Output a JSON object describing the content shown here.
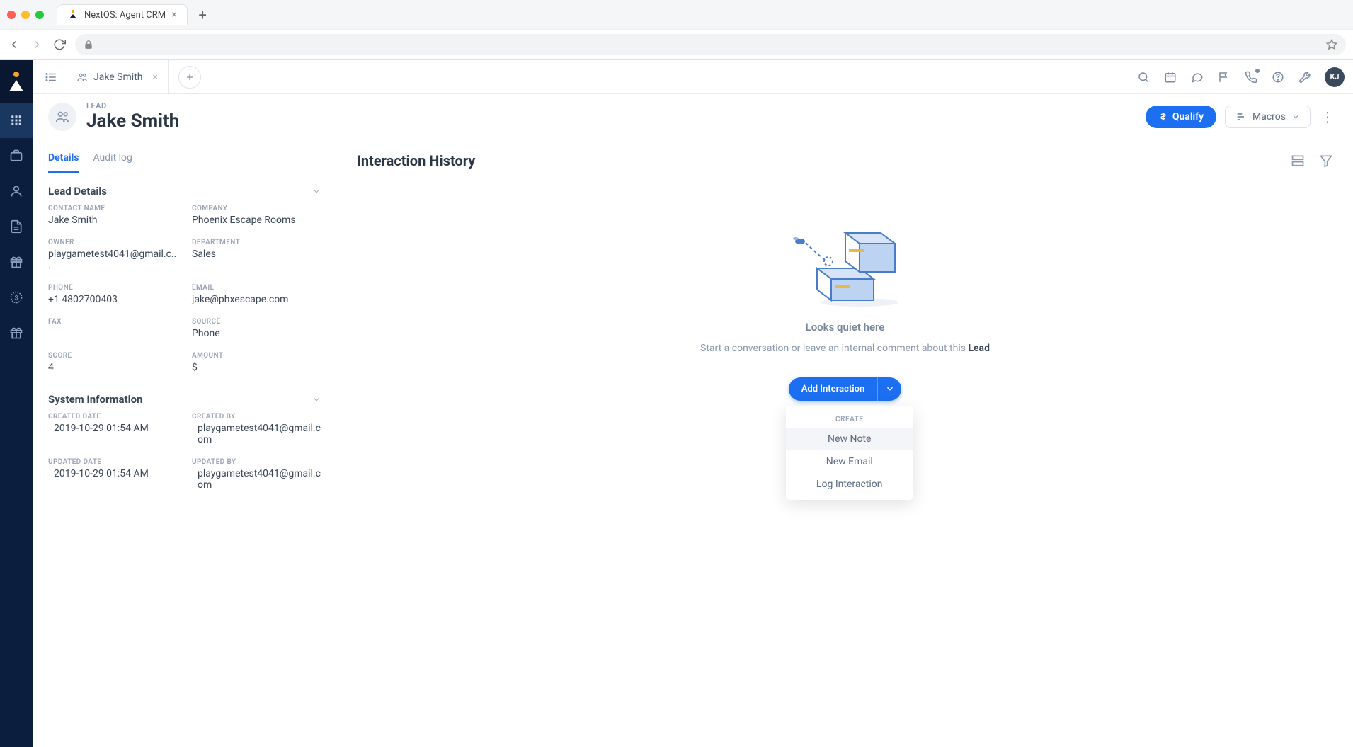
{
  "browser": {
    "tab_title": "NextOS: Agent CRM"
  },
  "workspace": {
    "tab_label": "Jake Smith",
    "avatar_initials": "KJ"
  },
  "record": {
    "type_label": "LEAD",
    "name": "Jake Smith",
    "qualify_label": "Qualify",
    "macros_label": "Macros"
  },
  "left_panel": {
    "tab_details": "Details",
    "tab_audit": "Audit log",
    "section_lead_details": "Lead Details",
    "section_system_info": "System Information",
    "fields": {
      "contact_name_label": "CONTACT NAME",
      "contact_name_value": "Jake Smith",
      "company_label": "COMPANY",
      "company_value": "Phoenix Escape Rooms",
      "owner_label": "OWNER",
      "owner_value": "playgametest4041@gmail.c...",
      "department_label": "DEPARTMENT",
      "department_value": "Sales",
      "phone_label": "PHONE",
      "phone_value": "+1 4802700403",
      "email_label": "EMAIL",
      "email_value": "jake@phxescape.com",
      "fax_label": "FAX",
      "fax_value": "",
      "source_label": "SOURCE",
      "source_value": "Phone",
      "score_label": "SCORE",
      "score_value": "4",
      "amount_label": "AMOUNT",
      "amount_value": "$",
      "created_date_label": "CREATED DATE",
      "created_date_value": "2019-10-29 01:54 AM",
      "created_by_label": "CREATED BY",
      "created_by_value": "playgametest4041@gmail.com",
      "updated_date_label": "UPDATED DATE",
      "updated_date_value": "2019-10-29 01:54 AM",
      "updated_by_label": "UPDATED BY",
      "updated_by_value": "playgametest4041@gmail.com"
    }
  },
  "right_panel": {
    "heading": "Interaction History",
    "empty_title": "Looks quiet here",
    "empty_text_prefix": "Start a conversation or leave an internal comment about this ",
    "empty_text_strong": "Lead",
    "add_interaction_label": "Add Interaction",
    "dropdown": {
      "header": "CREATE",
      "items": [
        "New Note",
        "New Email",
        "Log Interaction"
      ]
    }
  }
}
